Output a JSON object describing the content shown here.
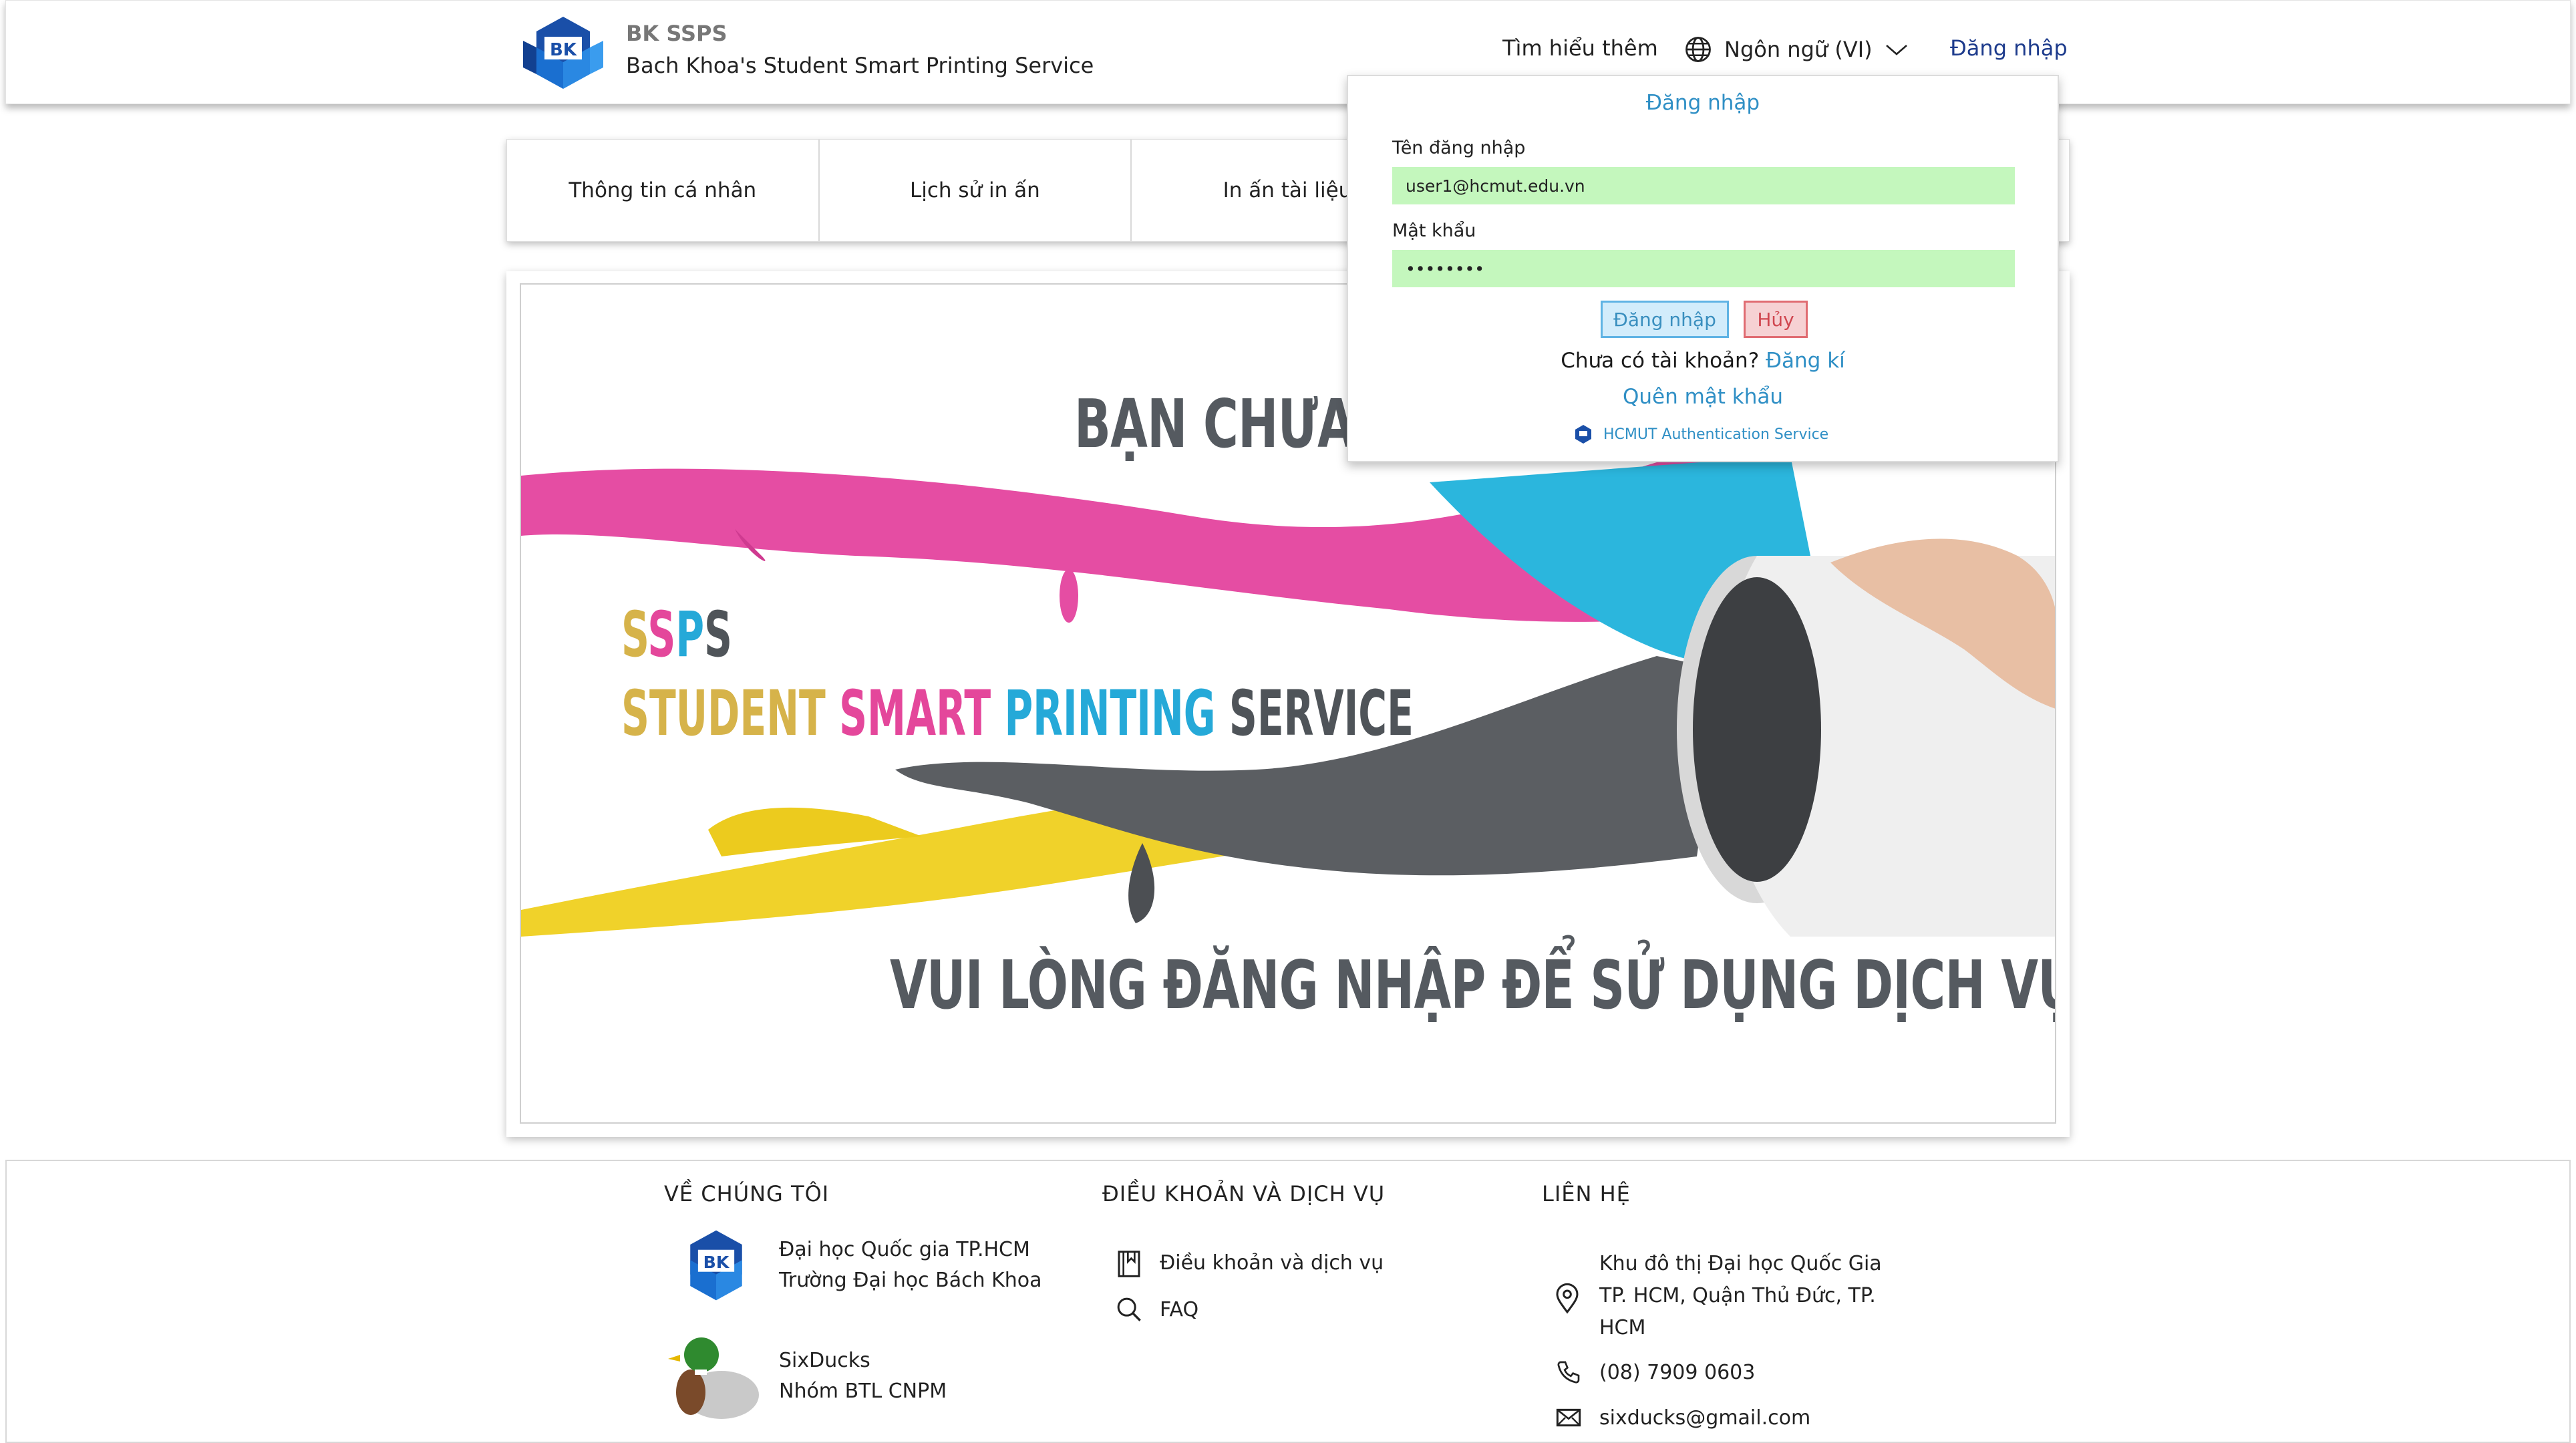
{
  "header": {
    "brand_title": "BK SSPS",
    "brand_subtitle": "Bach Khoa's Student Smart Printing Service",
    "learn_more": "Tìm hiểu thêm",
    "language": "Ngôn ngữ (VI)",
    "login": "Đăng nhập"
  },
  "tabs": [
    {
      "label": "Thông tin cá nhân"
    },
    {
      "label": "Lịch sử in ấn"
    },
    {
      "label": "In ấn tài liệu"
    },
    {
      "label": ""
    },
    {
      "label": ""
    }
  ],
  "banner": {
    "heading": "BẠN CHƯA ĐĂNG",
    "slogan_short": [
      "S",
      "S",
      "P",
      "S"
    ],
    "slogan_words": [
      "STUDENT",
      "SMART",
      "PRINTING",
      "SERVICE"
    ],
    "footer_text": "VUI LÒNG ĐĂNG NHẬP ĐỂ SỬ DỤNG DỊCH VỤ"
  },
  "login_popup": {
    "title": "Đăng nhập",
    "username_label": "Tên đăng nhập",
    "username_value": "user1@hcmut.edu.vn",
    "password_label": "Mật khẩu",
    "password_value": "••••••••",
    "login_button": "Đăng nhập",
    "cancel_button": "Hủy",
    "no_account_text": "Chưa có tài khoản?",
    "register_link": "Đăng kí",
    "forgot_password": "Quên mật khẩu",
    "auth_service": "HCMUT Authentication Service"
  },
  "footer": {
    "about": {
      "heading": "VỀ CHÚNG TÔI",
      "org_line1": "Đại học Quốc gia TP.HCM",
      "org_line2": "Trường Đại học Bách Khoa",
      "team_line1": "SixDucks",
      "team_line2": "Nhóm BTL CNPM"
    },
    "terms": {
      "heading": "ĐIỀU KHOẢN VÀ DỊCH VỤ",
      "terms_link": "Điều khoản và dịch vụ",
      "faq_link": "FAQ"
    },
    "contact": {
      "heading": "LIÊN HỆ",
      "address_line1": "Khu đô thị Đại học Quốc Gia",
      "address_line2": "TP. HCM, Quận Thủ Đức, TP.",
      "address_line3": "HCM",
      "phone": "(08) 7909 0603",
      "email": "sixducks@gmail.com"
    }
  },
  "colors": {
    "primary_blue": "#1d3b8c",
    "link_blue": "#2f8fc5",
    "input_green": "#c4f7bd",
    "pink": "#e4479b",
    "yellow": "#d6b34a",
    "cyan": "#25a9d8",
    "gray": "#4f5459"
  }
}
